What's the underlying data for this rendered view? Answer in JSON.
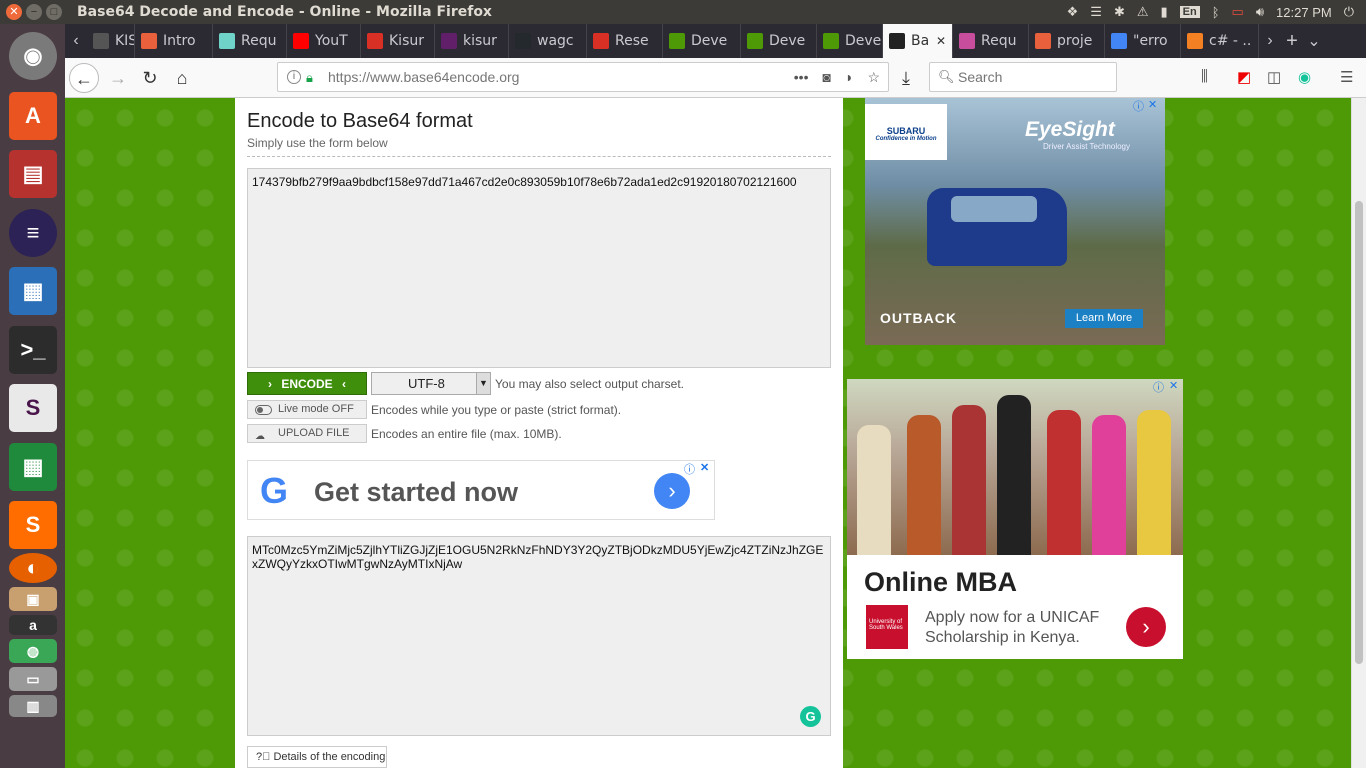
{
  "window": {
    "title": "Base64 Decode and Encode - Online - Mozilla Firefox"
  },
  "tray": {
    "keyboard": "En",
    "time": "12:27 PM"
  },
  "tabs": [
    {
      "label": "KISU",
      "color": "#555555",
      "icon": "tab-icon"
    },
    {
      "label": "Intro",
      "color": "#e8603c",
      "icon": "compass-icon"
    },
    {
      "label": "Requ",
      "color": "#6fd3c9",
      "icon": "page-icon"
    },
    {
      "label": "YouT",
      "color": "#ff0000",
      "icon": "youtube-icon"
    },
    {
      "label": "Kisur",
      "color": "#d93025",
      "icon": "gmail-icon"
    },
    {
      "label": "kisur",
      "color": "#611f69",
      "icon": "slack-icon"
    },
    {
      "label": "wagc",
      "color": "#24292e",
      "icon": "github-icon"
    },
    {
      "label": "Rese",
      "color": "#d93025",
      "icon": "gmail-icon"
    },
    {
      "label": "Deve",
      "color": "#4e9a06",
      "icon": "chart-icon"
    },
    {
      "label": "Deve",
      "color": "#4e9a06",
      "icon": "chart-icon"
    },
    {
      "label": "Deve",
      "color": "#4e9a06",
      "icon": "chart-icon"
    },
    {
      "label": "Ba",
      "color": "#222222",
      "icon": "base64-icon",
      "active": true
    },
    {
      "label": "Requ",
      "color": "#c84d9c",
      "icon": "page-icon"
    },
    {
      "label": "proje",
      "color": "#e8603c",
      "icon": "ubuntu-icon"
    },
    {
      "label": "\"erro",
      "color": "#4285f4",
      "icon": "google-icon"
    },
    {
      "label": "c# - ..",
      "color": "#f48024",
      "icon": "stackoverflow-icon"
    }
  ],
  "nav": {
    "url": "https://www.base64encode.org",
    "search_placeholder": "Search"
  },
  "page": {
    "title": "Encode to Base64 format",
    "subtitle": "Simply use the form below",
    "input_value": "174379bfb279f9aa9bdbcf158e97dd71a467cd2e0c893059b10f78e6b72ada1ed2c91920180702121600",
    "encode_label": "ENCODE",
    "charset": "UTF-8",
    "charset_hint": "You may also select output charset.",
    "live_mode_label": "Live mode OFF",
    "live_mode_hint": "Encodes while you type or paste (strict format).",
    "upload_label": "UPLOAD FILE",
    "upload_hint": "Encodes an entire file (max. 10MB).",
    "output_value": "MTc0Mzc5YmZiMjc5ZjlhYTliZGJjZjE1OGU5N2RkNzFhNDY3Y2QyZTBjODkzMDU5YjEwZjc4ZTZiNzJhZGExZWQyYzkxOTIwMTgwNzAyMTIxNjAw",
    "details_label": "Details of the encoding"
  },
  "ads": {
    "google_text": "Get started now",
    "subaru_brand": "SUBARU",
    "subaru_tagline": "Confidence in Motion",
    "eyesight": "EyeSight",
    "eyesight_sub": "Driver Assist Technology",
    "outback": "OUTBACK",
    "learn_more": "Learn More",
    "mba_title": "Online MBA",
    "mba_text": "Apply now for a UNICAF Scholarship in Kenya.",
    "uni_name": "University of South Wales"
  }
}
